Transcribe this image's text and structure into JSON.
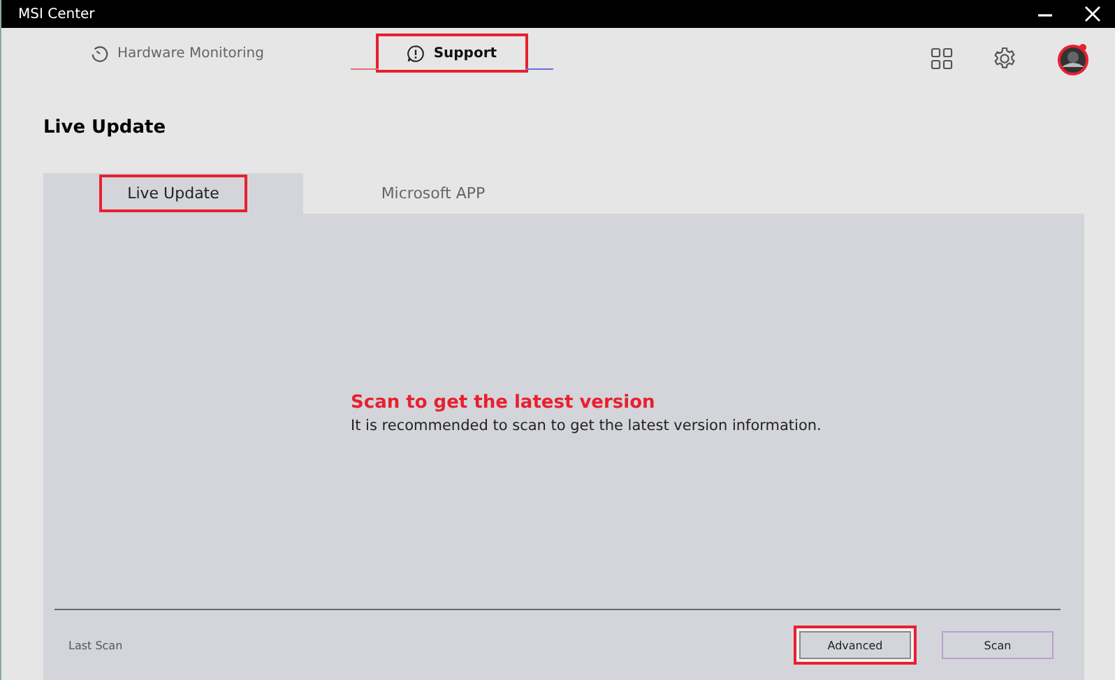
{
  "window": {
    "title": "MSI Center"
  },
  "nav_tabs": [
    {
      "label": "Hardware Monitoring",
      "kind": "gauge",
      "selected": false,
      "highlighted": false
    },
    {
      "label": "Support",
      "kind": "alert",
      "selected": true,
      "highlighted": true
    }
  ],
  "page_title": "Live Update",
  "tabs": [
    {
      "label": "Live Update",
      "selected": true,
      "highlighted": true
    },
    {
      "label": "Microsoft APP",
      "selected": false,
      "highlighted": false
    }
  ],
  "message": {
    "title": "Scan to get the latest version",
    "text": "It is recommended to scan to get the latest version information."
  },
  "footer": {
    "last_scan": "Last Scan",
    "buttons": [
      {
        "label": "Advanced",
        "highlighted": true
      },
      {
        "label": "Scan",
        "highlighted": false
      }
    ]
  }
}
